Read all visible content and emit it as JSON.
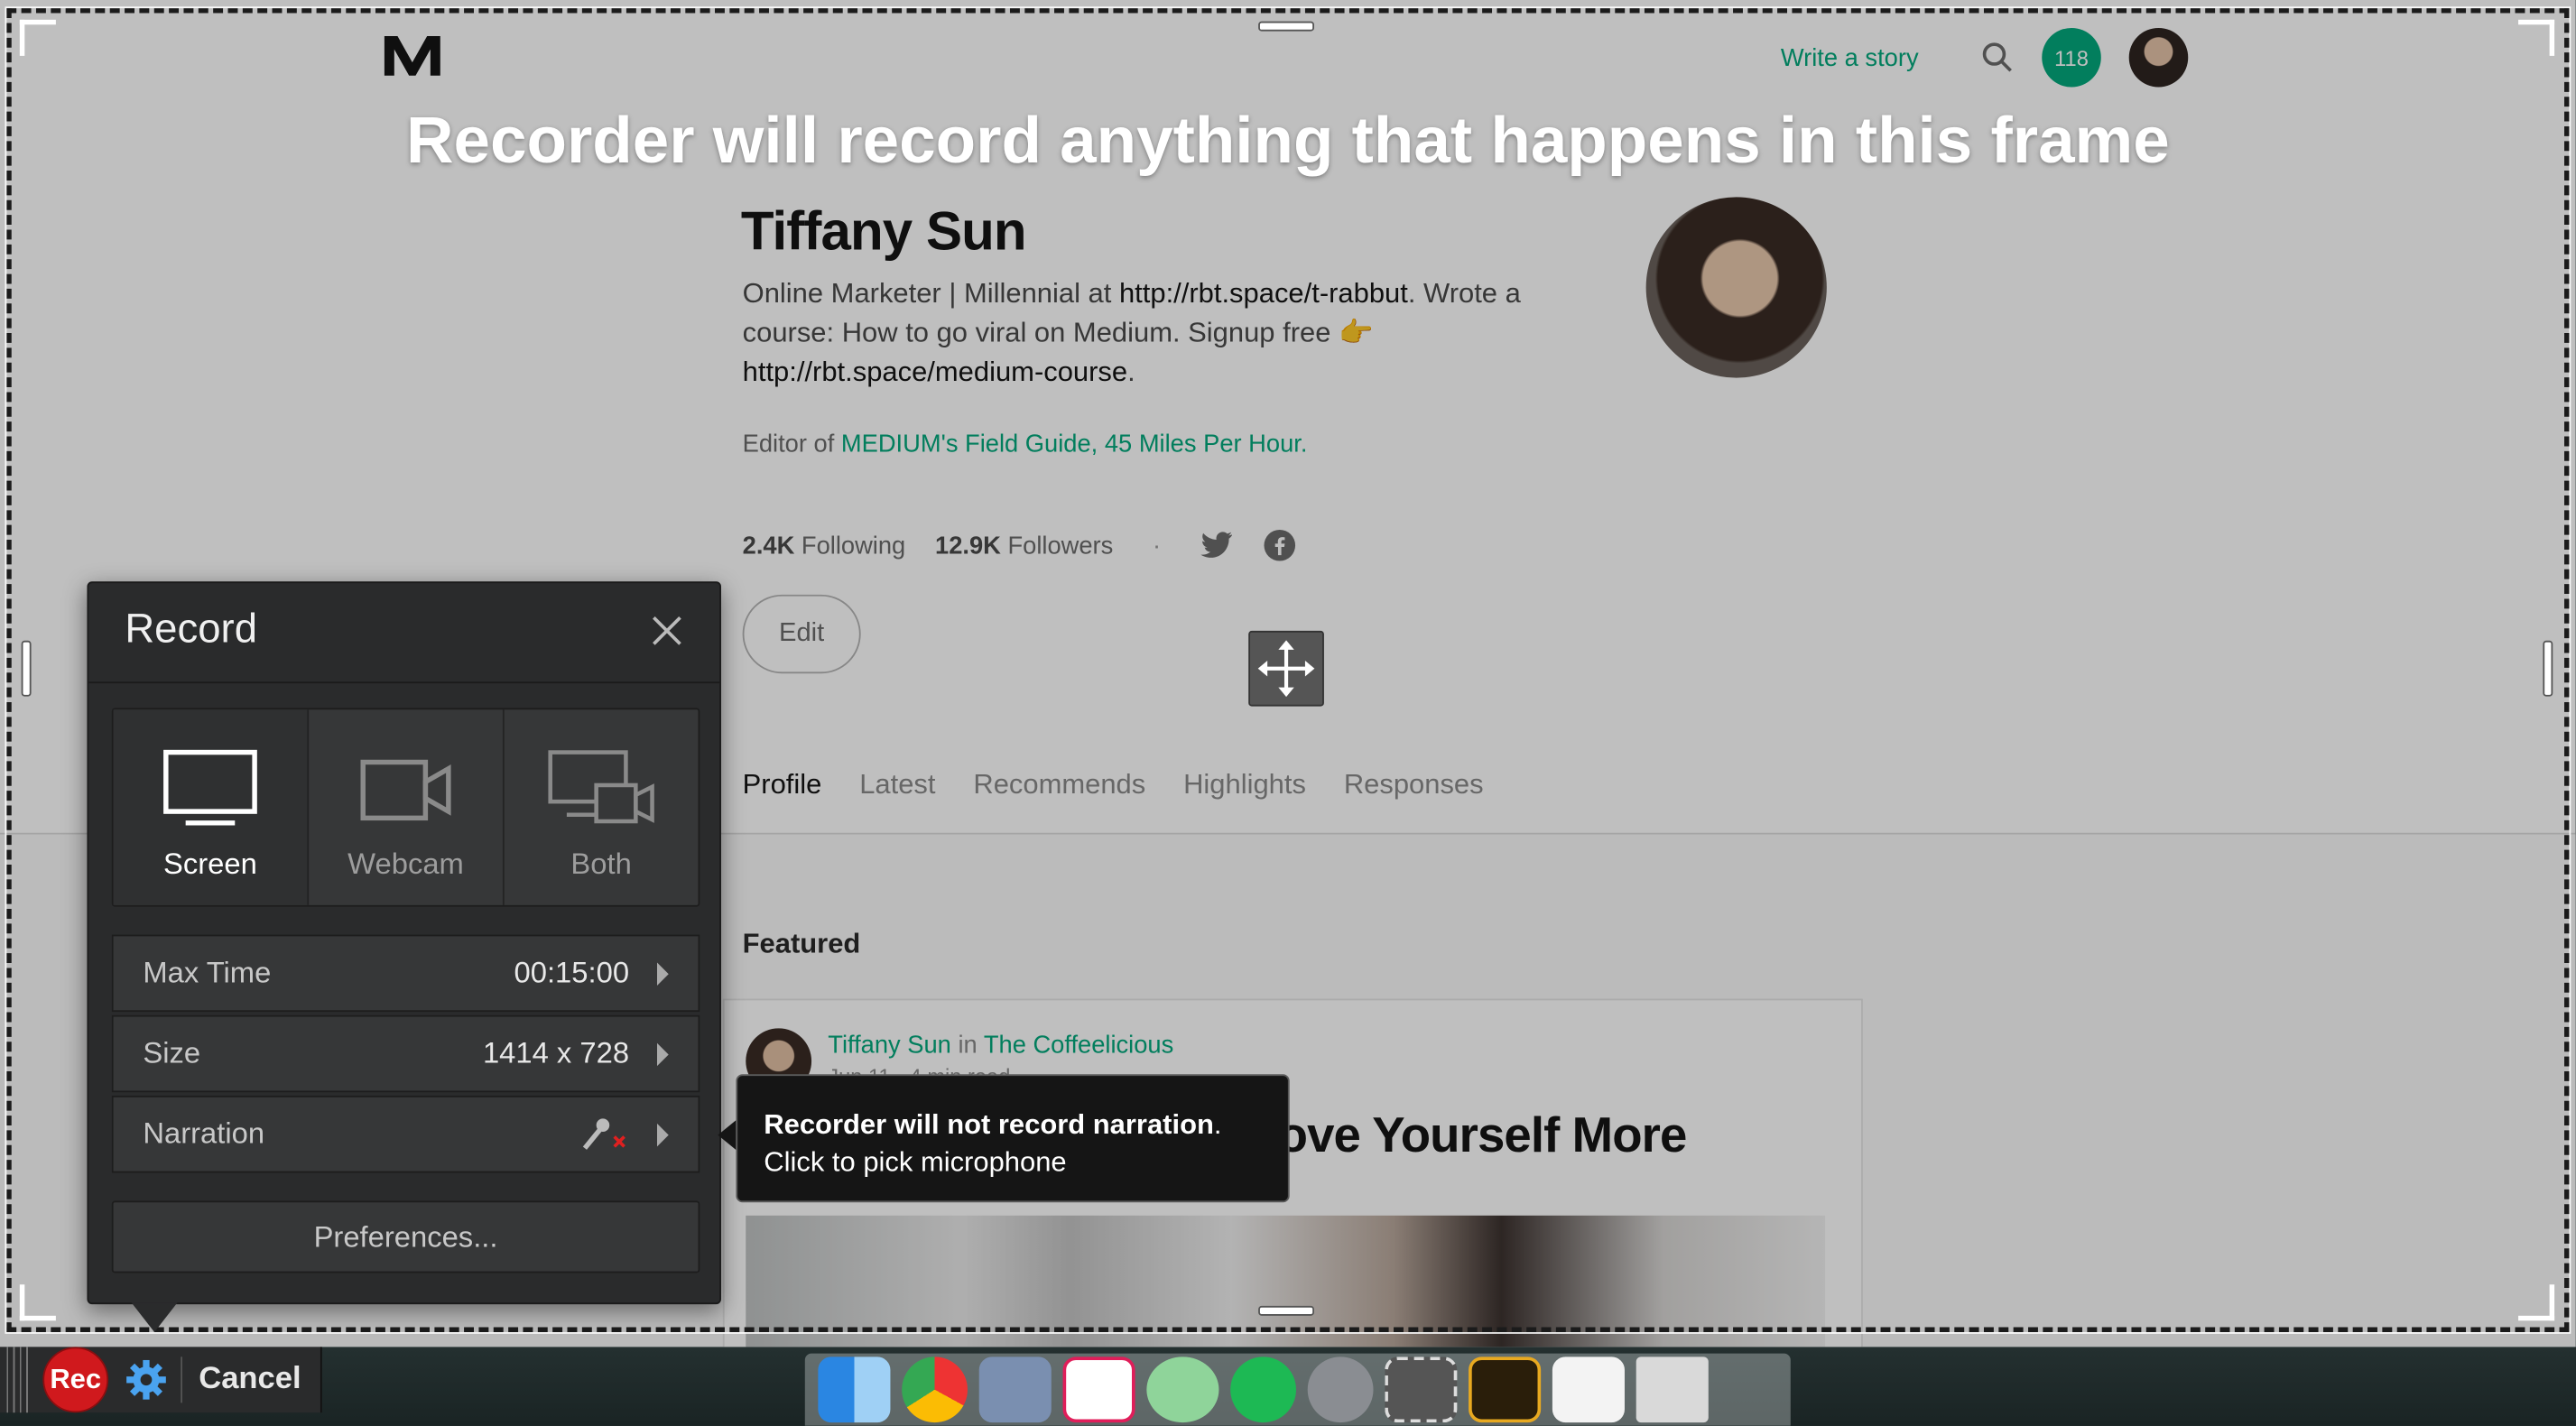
{
  "header": {
    "write_story": "Write a story",
    "notifications_count": "118"
  },
  "banner": {
    "text": "Recorder will record anything that happens in this frame"
  },
  "profile": {
    "name": "Tiffany Sun",
    "bio_1": "Online Marketer | Millennial at ",
    "bio_link_1": "http://rbt.space/t-rabbut",
    "bio_2": ". Wrote a course: How to go viral on Medium. Signup free 👉 ",
    "bio_link_2": "http://rbt.space/medium-course",
    "bio_3": ".",
    "editor_prefix": "Editor of ",
    "editor_pub_1": "MEDIUM's Field Guide",
    "editor_sep": ", ",
    "editor_pub_2": "45 Miles Per Hour",
    "editor_suffix": ".",
    "following_count": "2.4K",
    "following_label": "Following",
    "followers_count": "12.9K",
    "followers_label": "Followers",
    "dot": "·",
    "edit_label": "Edit"
  },
  "tabs": [
    {
      "label": "Profile",
      "active": true
    },
    {
      "label": "Latest"
    },
    {
      "label": "Recommends"
    },
    {
      "label": "Highlights"
    },
    {
      "label": "Responses"
    }
  ],
  "featured": {
    "heading": "Featured",
    "author": "Tiffany Sun",
    "in": "in",
    "publication": "The Coffeelicious",
    "meta": "Jun 11 · 4 min read",
    "title": "Love Yourself More"
  },
  "record_panel": {
    "title": "Record",
    "modes": [
      {
        "label": "Screen",
        "icon": "monitor-icon",
        "selected": true
      },
      {
        "label": "Webcam",
        "icon": "webcam-icon"
      },
      {
        "label": "Both",
        "icon": "monitor-webcam-icon"
      }
    ],
    "max_time_label": "Max Time",
    "max_time_value": "00:15:00",
    "size_label": "Size",
    "size_value": "1414 x 728",
    "narration_label": "Narration",
    "preferences_label": "Preferences..."
  },
  "tooltip": {
    "bold": "Recorder will not record narration",
    "bold_end": ".",
    "line2": "Click to pick microphone"
  },
  "toolbar": {
    "rec_label": "Rec",
    "cancel_label": "Cancel"
  },
  "colors": {
    "medium_green": "#03a87c",
    "rec_red": "#d0191d",
    "panel_dark": "#2a2b2c"
  }
}
